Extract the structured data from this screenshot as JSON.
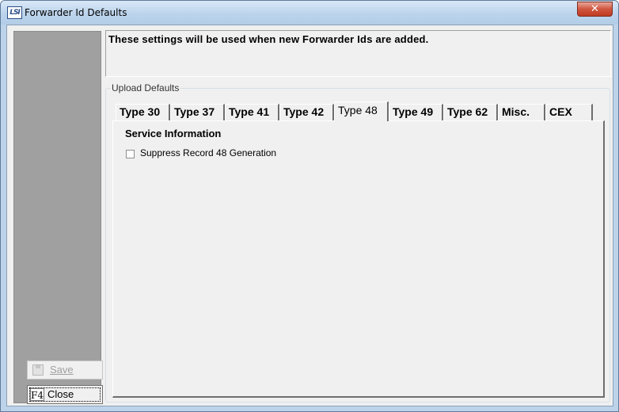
{
  "window": {
    "icon": "app-logo-icon",
    "icon_text": "LSI",
    "title": "Forwarder Id Defaults",
    "close_glyph": "✕"
  },
  "sidebar": {
    "save_button": {
      "label": "Save",
      "icon": "save-disk-icon",
      "enabled": false
    },
    "close_button": {
      "key_hint": "F4",
      "label": "Close",
      "enabled": true
    }
  },
  "info": {
    "message": "These settings will be used when new Forwarder Ids are added."
  },
  "upload_defaults": {
    "group_label": "Upload Defaults",
    "tabs": [
      {
        "label": "Type 30",
        "active": false
      },
      {
        "label": "Type 37",
        "active": false
      },
      {
        "label": "Type 41",
        "active": false
      },
      {
        "label": "Type 42",
        "active": false
      },
      {
        "label": "Type 48",
        "active": true
      },
      {
        "label": "Type 49",
        "active": false
      },
      {
        "label": "Type 62",
        "active": false
      },
      {
        "label": "Misc.",
        "active": false
      },
      {
        "label": "CEX",
        "active": false
      }
    ],
    "panel": {
      "heading": "Service Information",
      "checkbox": {
        "label": "Suppress Record 48 Generation",
        "checked": false
      }
    }
  },
  "colors": {
    "titlebar": "#bcd4ec",
    "close_button": "#c9462f",
    "left_panel": "#a0a0a0",
    "form_background": "#f0f0f0"
  }
}
